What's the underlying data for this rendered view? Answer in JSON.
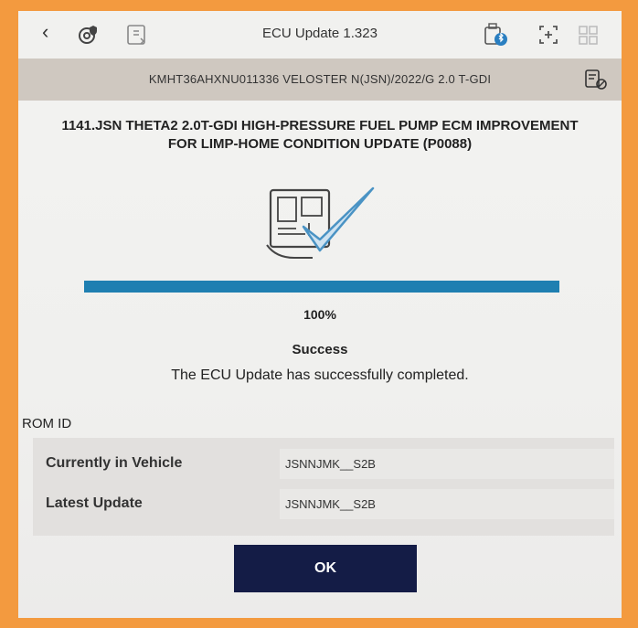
{
  "header": {
    "title": "ECU Update 1.323"
  },
  "vehicle": {
    "info": "KMHT36AHXNU011336  VELOSTER N(JSN)/2022/G 2.0 T-GDI"
  },
  "update": {
    "title_line1": "1141.JSN THETA2 2.0T-GDI HIGH-PRESSURE FUEL PUMP ECM IMPROVEMENT",
    "title_line2": "FOR LIMP-HOME CONDITION UPDATE (P0088)",
    "progress_percent": 100,
    "progress_label": "100%",
    "status": "Success",
    "message": "The ECU Update has successfully completed."
  },
  "rom": {
    "heading": "ROM ID",
    "rows": [
      {
        "label": "Currently in Vehicle",
        "value": "JSNNJMK__S2B"
      },
      {
        "label": "Latest Update",
        "value": "JSNNJMK__S2B"
      }
    ]
  },
  "actions": {
    "ok_label": "OK"
  },
  "colors": {
    "progress": "#1f7fb1",
    "ok_button": "#141c46",
    "frame": "#f39a3f",
    "check": "#4a93c4"
  }
}
